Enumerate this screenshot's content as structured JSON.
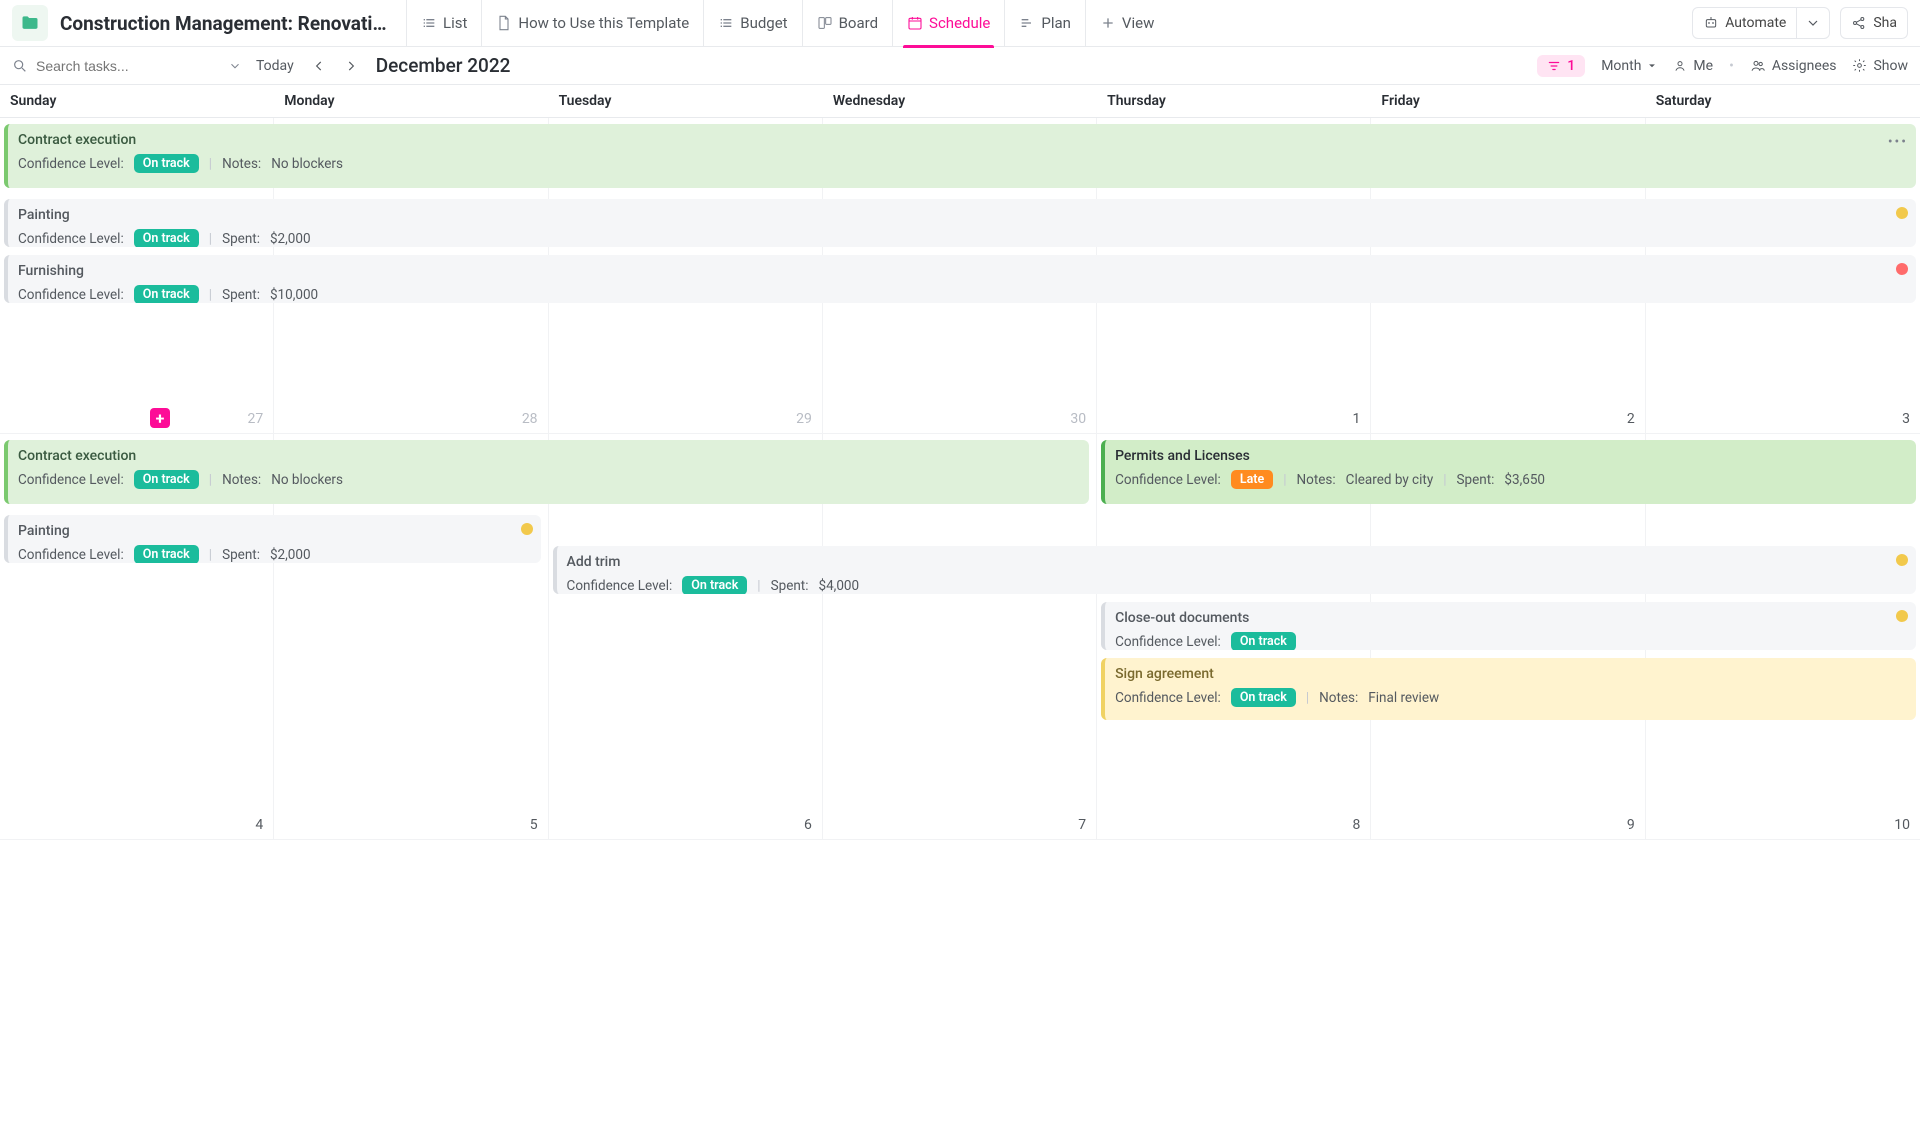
{
  "header": {
    "page_title": "Construction Management: Renovatio…",
    "tabs": [
      {
        "label": "List"
      },
      {
        "label": "How to Use this Template"
      },
      {
        "label": "Budget"
      },
      {
        "label": "Board"
      },
      {
        "label": "Schedule"
      },
      {
        "label": "Plan"
      },
      {
        "label": "View"
      }
    ],
    "automate": "Automate",
    "share": "Sha"
  },
  "controls": {
    "search_placeholder": "Search tasks...",
    "today": "Today",
    "month_label": "December 2022",
    "filter_count": "1",
    "view_mode": "Month",
    "me": "Me",
    "assignees": "Assignees",
    "show": "Show"
  },
  "days": [
    "Sunday",
    "Monday",
    "Tuesday",
    "Wednesday",
    "Thursday",
    "Friday",
    "Saturday"
  ],
  "week1": {
    "dates": [
      "27",
      "28",
      "29",
      "30",
      "1",
      "2",
      "3"
    ],
    "dim": [
      true,
      true,
      true,
      true,
      false,
      false,
      false
    ],
    "tasks": [
      {
        "title": "Contract execution",
        "confidence_lbl": "Confidence Level:",
        "badge": "On track",
        "notes_lbl": "Notes:",
        "notes": "No blockers"
      },
      {
        "title": "Painting",
        "confidence_lbl": "Confidence Level:",
        "badge": "On track",
        "spent_lbl": "Spent:",
        "spent": "$2,000"
      },
      {
        "title": "Furnishing",
        "confidence_lbl": "Confidence Level:",
        "badge": "On track",
        "spent_lbl": "Spent:",
        "spent": "$10,000"
      }
    ]
  },
  "week2": {
    "dates": [
      "4",
      "5",
      "6",
      "7",
      "8",
      "9",
      "10"
    ],
    "tasks": {
      "contract": {
        "title": "Contract execution",
        "confidence_lbl": "Confidence Level:",
        "badge": "On track",
        "notes_lbl": "Notes:",
        "notes": "No blockers"
      },
      "permits": {
        "title": "Permits and Licenses",
        "confidence_lbl": "Confidence Level:",
        "badge": "Late",
        "notes_lbl": "Notes:",
        "notes": "Cleared by city",
        "spent_lbl": "Spent:",
        "spent": "$3,650"
      },
      "painting": {
        "title": "Painting",
        "confidence_lbl": "Confidence Level:",
        "badge": "On track",
        "spent_lbl": "Spent:",
        "spent": "$2,000"
      },
      "trim": {
        "title": "Add trim",
        "confidence_lbl": "Confidence Level:",
        "badge": "On track",
        "spent_lbl": "Spent:",
        "spent": "$4,000"
      },
      "closeout": {
        "title": "Close-out documents",
        "confidence_lbl": "Confidence Level:",
        "badge": "On track"
      },
      "sign": {
        "title": "Sign agreement",
        "confidence_lbl": "Confidence Level:",
        "badge": "On track",
        "notes_lbl": "Notes:",
        "notes": "Final review"
      }
    }
  }
}
